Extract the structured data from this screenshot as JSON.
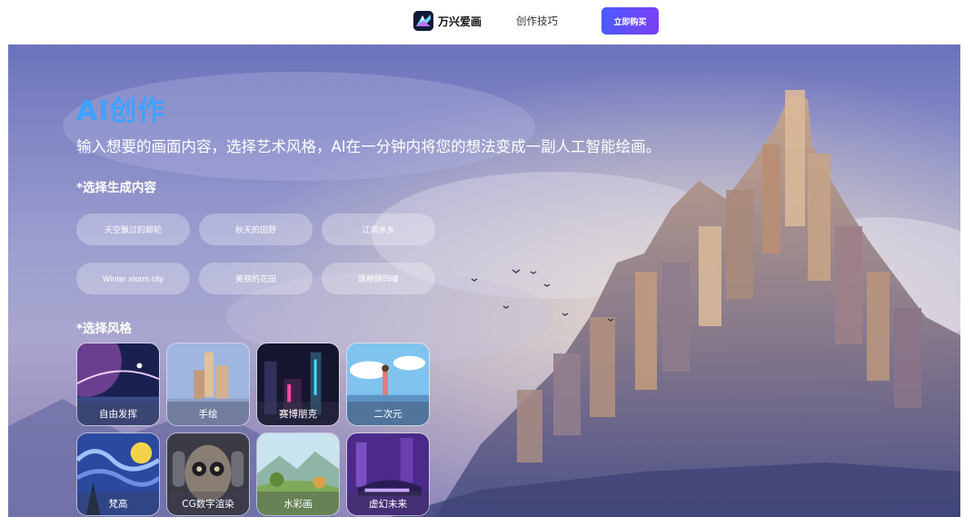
{
  "nav": {
    "brand_name": "万兴爱画",
    "link_label": "创作技巧",
    "buy_label": "立即购买"
  },
  "hero": {
    "title": "AI创作",
    "subtitle": "输入想要的画面内容，选择艺术风格，AI在一分钟内将您的想法变成一副人工智能绘画。",
    "content_label": "*选择生成内容",
    "content_chips": [
      "天空飘过的邮轮",
      "秋天的田野",
      "江南水乡",
      "Winter storm city",
      "美丽的花田",
      "珠穆朗玛峰"
    ],
    "style_label": "*选择风格",
    "styles": [
      "自由发挥",
      "手绘",
      "赛博朋克",
      "二次元",
      "梵高",
      "CG数字渲染",
      "水彩画",
      "虚幻未来"
    ]
  },
  "colors": {
    "title_blue": "#3fa2ff",
    "buy_gradient_start": "#4b5bff",
    "buy_gradient_end": "#7b3ff4"
  }
}
